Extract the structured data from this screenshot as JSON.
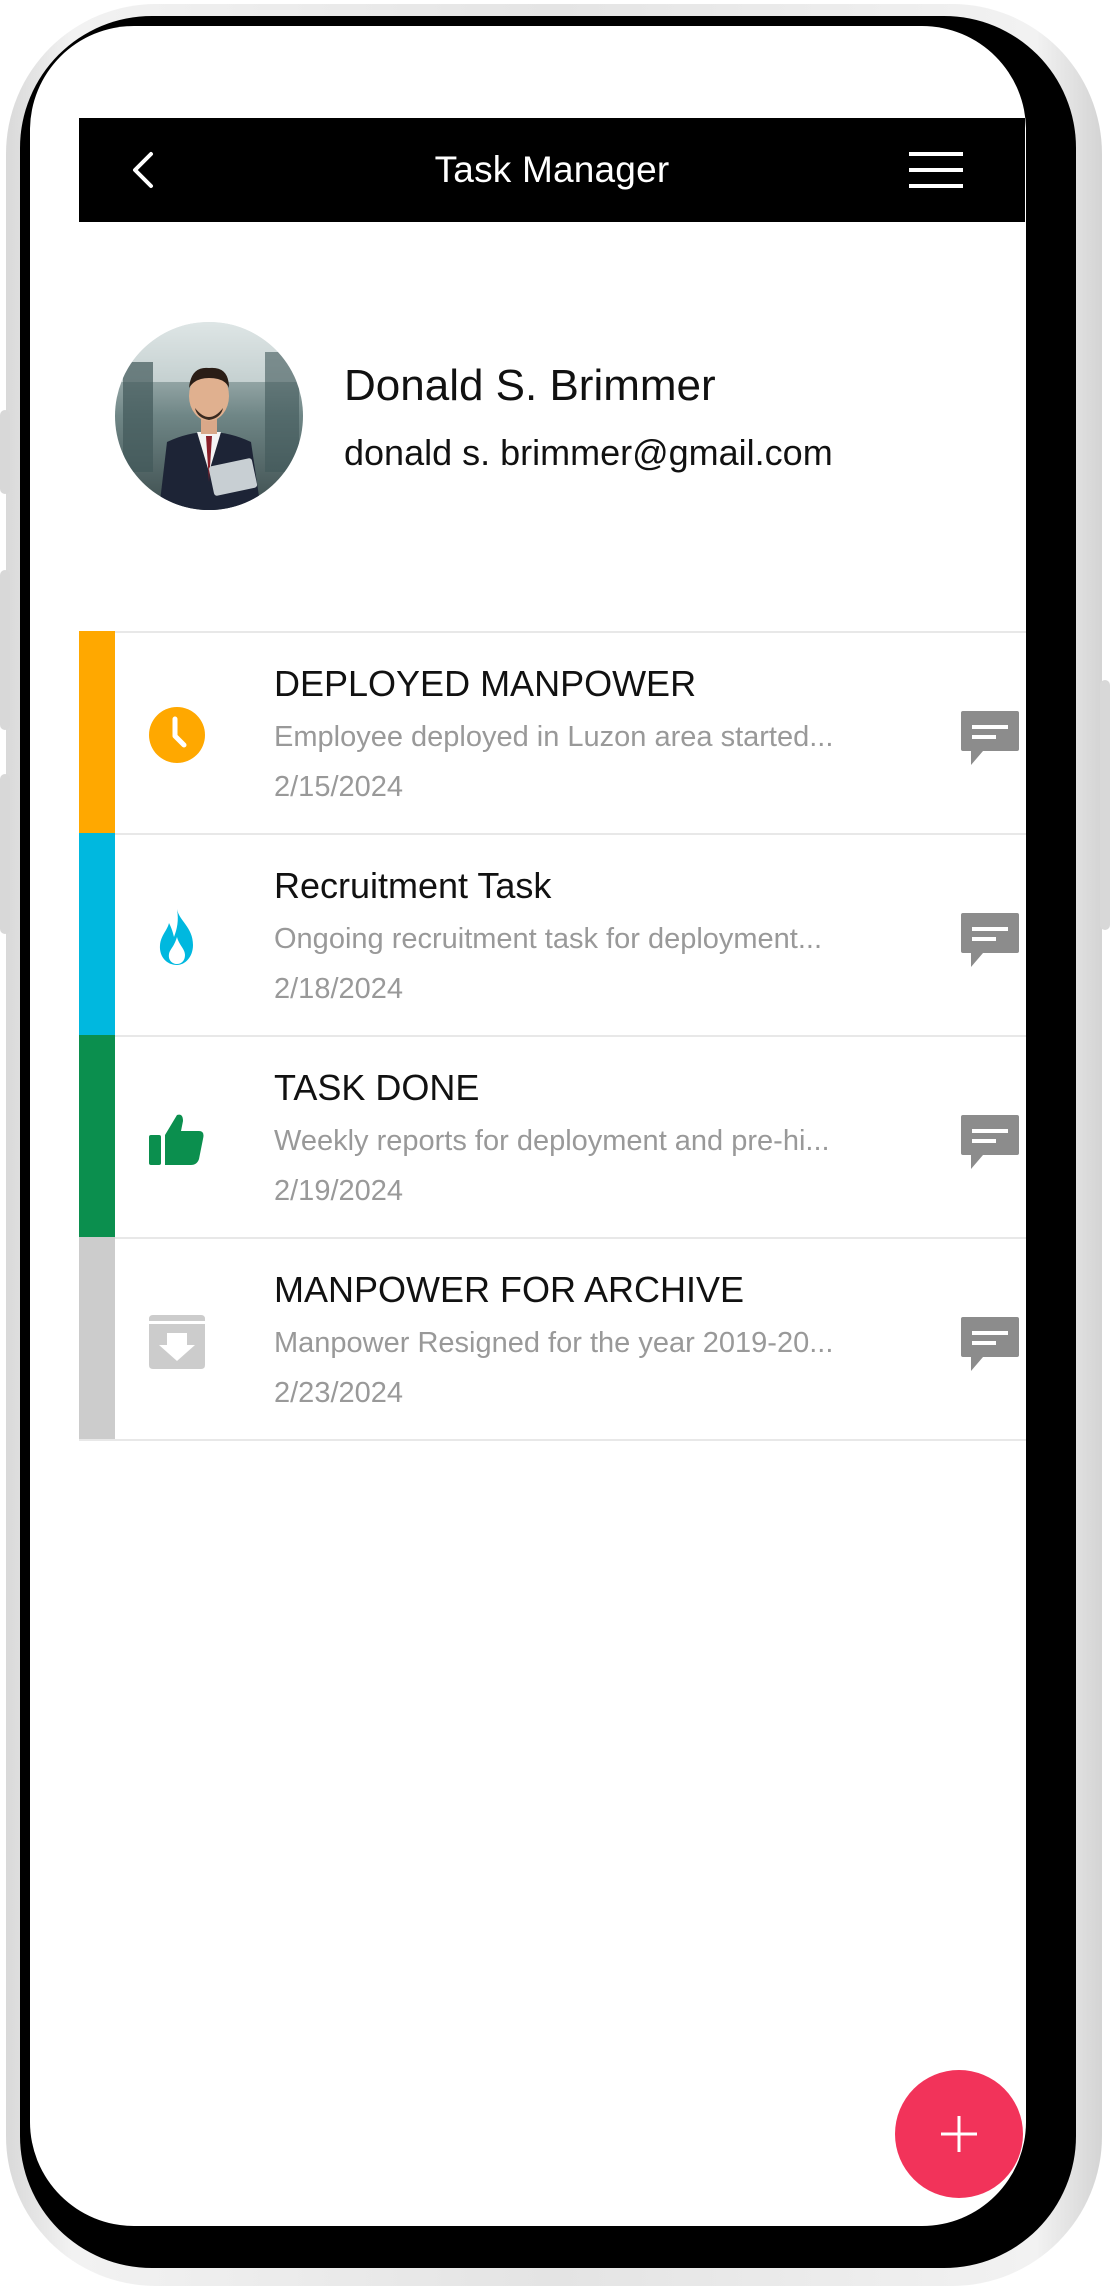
{
  "header": {
    "title": "Task Manager",
    "back_icon": "chevron-left-icon",
    "menu_icon": "hamburger-menu-icon"
  },
  "profile": {
    "name": "Donald S. Brimmer",
    "email": "donald s. brimmer@gmail.com"
  },
  "tasks": [
    {
      "title": "DEPLOYED MANPOWER",
      "description": "Employee deployed in Luzon area started...",
      "date": "2/15/2024",
      "color": "#ffa800",
      "icon": "clock-icon"
    },
    {
      "title": "Recruitment Task",
      "description": "Ongoing recruitment task for deployment...",
      "date": "2/18/2024",
      "color": "#00b8df",
      "icon": "flame-icon"
    },
    {
      "title": "TASK DONE",
      "description": "Weekly reports for deployment and pre-hi...",
      "date": "2/19/2024",
      "color": "#0b8f4e",
      "icon": "thumbs-up-icon"
    },
    {
      "title": "MANPOWER FOR ARCHIVE",
      "description": "Manpower Resigned for the year 2019-20...",
      "date": "2/23/2024",
      "color": "#cccccc",
      "icon": "archive-icon"
    }
  ],
  "fab": {
    "icon": "plus-icon",
    "color": "#f2335a"
  }
}
